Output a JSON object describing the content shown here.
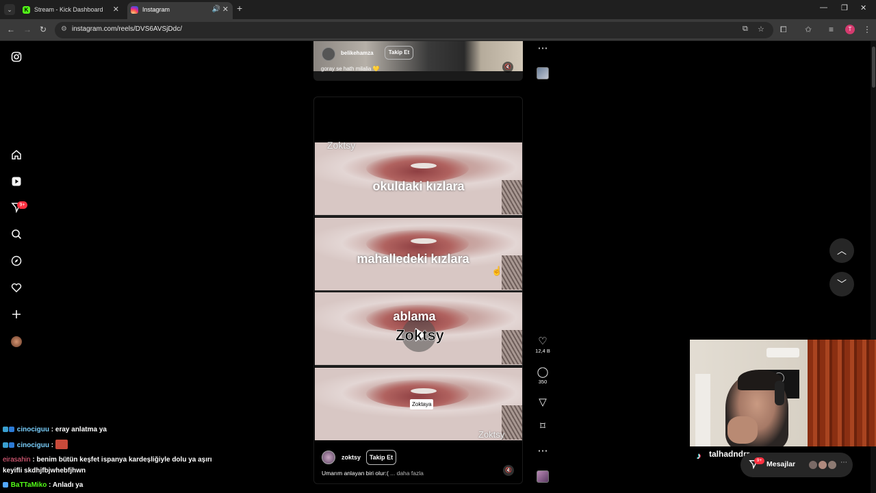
{
  "browser": {
    "tabs": [
      {
        "title": "Stream - Kick Dashboard",
        "favicon": "K"
      },
      {
        "title": "Instagram",
        "favicon": ""
      }
    ],
    "url": "instagram.com/reels/DVS6AVSjDdc/",
    "profile_initial": "T"
  },
  "nav": {
    "messages_badge": "9+"
  },
  "prev_reel": {
    "username": "belikehamza",
    "follow_label": "Takip Et",
    "caption": "goray se hath milalia 💛"
  },
  "reel": {
    "watermark": "Zoktsy",
    "overlay_lines": [
      "okuldaki kızlara",
      "mahalledeki kızlara",
      "ablama"
    ],
    "sticker": "Zoktaya",
    "username": "zoktsy",
    "follow_label": "Takip Et",
    "caption": "Umarım anlayan biri olur:(",
    "caption_more": "... daha fazla",
    "likes": "12,4 B",
    "comments": "350"
  },
  "chat": [
    {
      "user": "cinociguu",
      "user_color": "#7ad0ff",
      "text": ": eray anlatma ya"
    },
    {
      "user": "cinociguu",
      "user_color": "#7ad0ff",
      "text": ":"
    },
    {
      "user": "eirasahin",
      "user_color": "#ff6b8b",
      "text": ": benim bütün keşfet ispanya kardeşliğiyle dolu ya aşırı"
    },
    {
      "user": "",
      "user_color": "#ffffff",
      "text": "keyifli skdhjfbjwhebfjhwn"
    },
    {
      "user": "BaTTaMiko",
      "user_color": "#53fc18",
      "text": ": Anladı ya"
    }
  ],
  "streamer": {
    "name": "talhadndrr"
  },
  "messages": {
    "label": "Mesajlar",
    "badge": "9+"
  },
  "colors": {
    "background": "#000000",
    "badge": "#ff3040",
    "kick": "#53fc18"
  }
}
